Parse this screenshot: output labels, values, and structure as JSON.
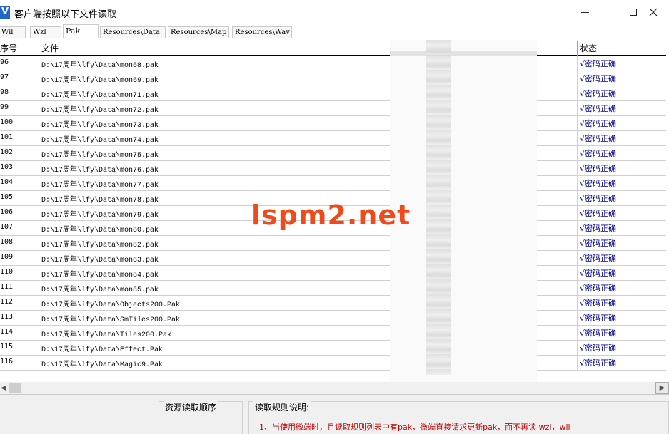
{
  "window": {
    "title": "客户端按照以下文件读取",
    "app_icon_letter": "V"
  },
  "tabs": [
    {
      "label": "Wil",
      "active": false
    },
    {
      "label": "Wzl",
      "active": false
    },
    {
      "label": "Pak",
      "active": true
    },
    {
      "label": "Resources\\Data",
      "active": false
    },
    {
      "label": "Resources\\Map",
      "active": false
    },
    {
      "label": "Resources\\Wav",
      "active": false
    }
  ],
  "table": {
    "headers": {
      "index": "序号",
      "file": "文件",
      "status": "状态"
    },
    "rows": [
      {
        "index": "96",
        "file": "D:\\17周年\\lfy\\Data\\mon68.pak",
        "status": "√密码正确"
      },
      {
        "index": "97",
        "file": "D:\\17周年\\lfy\\Data\\mon69.pak",
        "status": "√密码正确"
      },
      {
        "index": "98",
        "file": "D:\\17周年\\lfy\\Data\\mon71.pak",
        "status": "√密码正确"
      },
      {
        "index": "99",
        "file": "D:\\17周年\\lfy\\Data\\mon72.pak",
        "status": "√密码正确"
      },
      {
        "index": "100",
        "file": "D:\\17周年\\lfy\\Data\\mon73.pak",
        "status": "√密码正确"
      },
      {
        "index": "101",
        "file": "D:\\17周年\\lfy\\Data\\mon74.pak",
        "status": "√密码正确"
      },
      {
        "index": "102",
        "file": "D:\\17周年\\lfy\\Data\\mon75.pak",
        "status": "√密码正确"
      },
      {
        "index": "103",
        "file": "D:\\17周年\\lfy\\Data\\mon76.pak",
        "status": "√密码正确"
      },
      {
        "index": "104",
        "file": "D:\\17周年\\lfy\\Data\\mon77.pak",
        "status": "√密码正确"
      },
      {
        "index": "105",
        "file": "D:\\17周年\\lfy\\Data\\mon78.pak",
        "status": "√密码正确"
      },
      {
        "index": "106",
        "file": "D:\\17周年\\lfy\\Data\\mon79.pak",
        "status": "√密码正确"
      },
      {
        "index": "107",
        "file": "D:\\17周年\\lfy\\Data\\mon80.pak",
        "status": "√密码正确"
      },
      {
        "index": "108",
        "file": "D:\\17周年\\lfy\\Data\\mon82.pak",
        "status": "√密码正确"
      },
      {
        "index": "109",
        "file": "D:\\17周年\\lfy\\Data\\mon83.pak",
        "status": "√密码正确"
      },
      {
        "index": "110",
        "file": "D:\\17周年\\lfy\\Data\\mon84.pak",
        "status": "√密码正确"
      },
      {
        "index": "111",
        "file": "D:\\17周年\\lfy\\Data\\mon85.pak",
        "status": "√密码正确"
      },
      {
        "index": "112",
        "file": "D:\\17周年\\lfy\\Data\\Objects200.Pak",
        "status": "√密码正确"
      },
      {
        "index": "113",
        "file": "D:\\17周年\\lfy\\Data\\SmTiles200.Pak",
        "status": "√密码正确"
      },
      {
        "index": "114",
        "file": "D:\\17周年\\lfy\\Data\\Tiles200.Pak",
        "status": "√密码正确"
      },
      {
        "index": "115",
        "file": "D:\\17周年\\lfy\\Data\\Effect.Pak",
        "status": "√密码正确"
      },
      {
        "index": "116",
        "file": "D:\\17周年\\lfy\\Data\\Magic9.Pak",
        "status": "√密码正确"
      }
    ]
  },
  "bottom": {
    "resource_order_label": "资源读取顺序",
    "rules_label": "读取规则说明:",
    "rule_1": "1、当使用微端时，且读取规则列表中有pak，微端直接请求更新pak，而不再读 wzl，wil"
  },
  "watermark": "lspm2.net",
  "colors": {
    "status_text": "#000090",
    "rule_text": "#c00000",
    "watermark": "#f04a1a",
    "app_icon": "#1f66c9"
  }
}
